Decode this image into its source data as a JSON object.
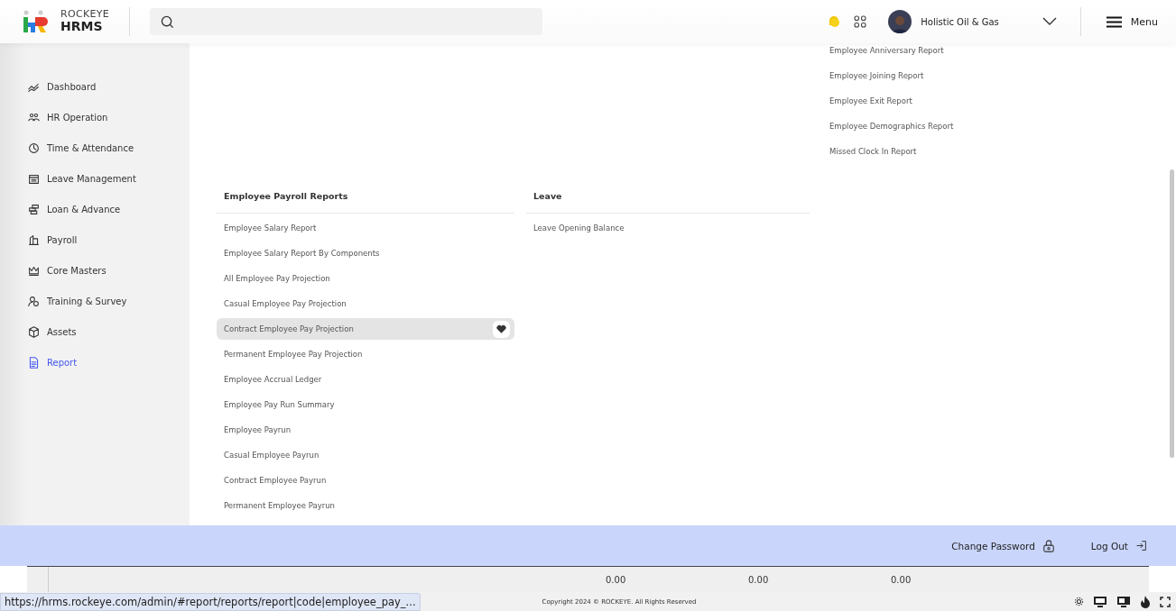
{
  "header": {
    "brand_top": "ROCKEYE",
    "brand_bottom": "HRMS",
    "company": "Holistic Oil & Gas",
    "menu_label": "Menu"
  },
  "sidebar": {
    "items": [
      {
        "label": "Dashboard",
        "selected": false
      },
      {
        "label": "HR Operation",
        "selected": false
      },
      {
        "label": "Time & Attendance",
        "selected": false
      },
      {
        "label": "Leave Management",
        "selected": false
      },
      {
        "label": "Loan & Advance",
        "selected": false
      },
      {
        "label": "Payroll",
        "selected": false
      },
      {
        "label": "Core Masters",
        "selected": false
      },
      {
        "label": "Training & Survey",
        "selected": false
      },
      {
        "label": "Assets",
        "selected": false
      },
      {
        "label": "Report",
        "selected": true
      }
    ]
  },
  "scrolled_group": {
    "items": [
      {
        "label": "Employee Anniversary Report",
        "selected": false
      },
      {
        "label": "Employee Joining Report",
        "selected": false
      },
      {
        "label": "Employee Exit Report",
        "selected": false
      },
      {
        "label": "Employee Demographics Report",
        "selected": false
      },
      {
        "label": "Missed Clock In Report",
        "selected": false
      }
    ]
  },
  "report_groups": [
    {
      "title": "Employee Payroll Reports",
      "items": [
        {
          "label": "Employee Salary Report",
          "selected": false
        },
        {
          "label": "Employee Salary Report By Components",
          "selected": false
        },
        {
          "label": "All Employee Pay Projection",
          "selected": false
        },
        {
          "label": "Casual Employee Pay Projection",
          "selected": false
        },
        {
          "label": "Contract Employee Pay Projection",
          "selected": true
        },
        {
          "label": "Permanent Employee Pay Projection",
          "selected": false
        },
        {
          "label": "Employee Accrual Ledger",
          "selected": false
        },
        {
          "label": "Employee Pay Run Summary",
          "selected": false
        },
        {
          "label": "Employee Payrun",
          "selected": false
        },
        {
          "label": "Casual Employee Payrun",
          "selected": false
        },
        {
          "label": "Contract Employee Payrun",
          "selected": false
        },
        {
          "label": "Permanent Employee Payrun",
          "selected": false
        }
      ]
    },
    {
      "title": "Leave",
      "items": [
        {
          "label": "Leave Opening Balance",
          "selected": false
        }
      ]
    }
  ],
  "account_bar": {
    "change_password": "Change Password",
    "log_out": "Log Out"
  },
  "table_values": [
    "0.00",
    "0.00",
    "0.00"
  ],
  "status_bar": {
    "url": "https://hrms.rockeye.com/admin/#report/reports/report|code|employee_pay_...",
    "copyright": "Copyright 2024 © ROCKEYE. All Rights Reserved"
  }
}
